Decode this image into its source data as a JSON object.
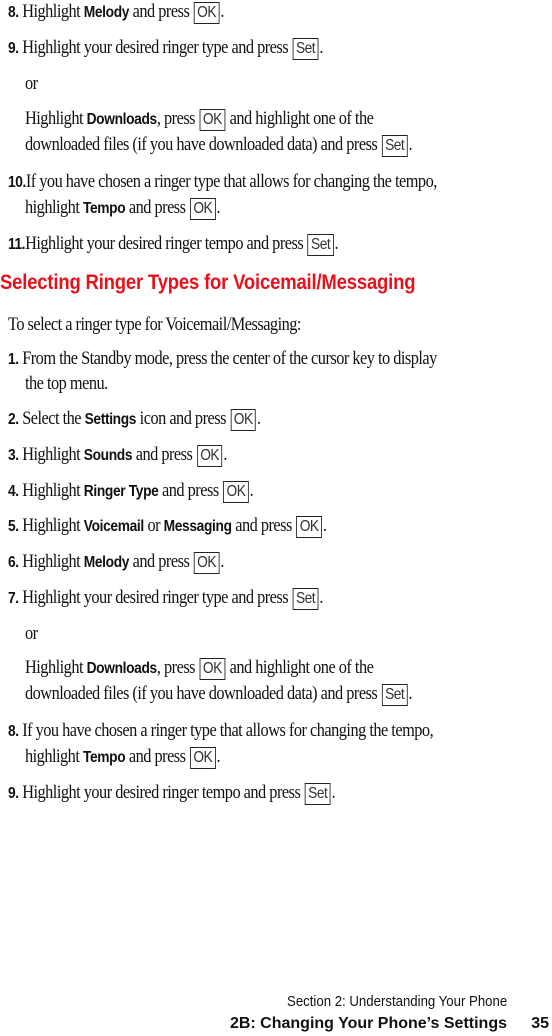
{
  "block1": {
    "s8": {
      "num": "8.",
      "pre": "Highlight ",
      "bold": "Melody",
      "post": " and press ",
      "key": "OK",
      "end": "."
    },
    "s9": {
      "num": "9.",
      "pre": "Highlight your desired ringer type and press ",
      "key": "Set",
      "end": "."
    },
    "or": "or",
    "alt_l1": {
      "pre": "Highlight ",
      "bold": "Downloads",
      "mid": ", press ",
      "key": "OK",
      "post": " and highlight one of the"
    },
    "alt_l2": {
      "pre": "downloaded files (if you have downloaded data) and press ",
      "key": "Set",
      "end": "."
    },
    "s10": {
      "num": "10.",
      "l1": "If you have chosen a ringer type that allows for changing the tempo,",
      "pre": "highlight ",
      "bold": "Tempo",
      "post": " and press ",
      "key": "OK",
      "end": "."
    },
    "s11": {
      "num": "11.",
      "pre": "Highlight your desired ringer tempo and press ",
      "key": "Set",
      "end": "."
    }
  },
  "heading": "Selecting Ringer Types for Voicemail/Messaging",
  "intro": "To select a ringer type for Voicemail/Messaging:",
  "block2": {
    "s1": {
      "num": "1.",
      "l1": "From the Standby mode, press the center of the cursor key to display",
      "l2": "the top menu."
    },
    "s2": {
      "num": "2.",
      "pre": "Select the ",
      "bold": "Settings",
      "post": " icon and press ",
      "key": "OK",
      "end": "."
    },
    "s3": {
      "num": "3.",
      "pre": "Highlight ",
      "bold": "Sounds",
      "post": " and press ",
      "key": "OK",
      "end": "."
    },
    "s4": {
      "num": "4.",
      "pre": "Highlight ",
      "bold": "Ringer Type",
      "post": " and press ",
      "key": "OK",
      "end": "."
    },
    "s5": {
      "num": "5.",
      "pre": "Highlight ",
      "bold": "Voicemail",
      "mid": " or ",
      "bold2": "Messaging",
      "post": " and press ",
      "key": "OK",
      "end": "."
    },
    "s6": {
      "num": "6.",
      "pre": "Highlight ",
      "bold": "Melody",
      "post": " and press ",
      "key": "OK",
      "end": "."
    },
    "s7": {
      "num": "7.",
      "pre": "Highlight your desired ringer type and press ",
      "key": "Set",
      "end": "."
    },
    "or": "or",
    "alt_l1": {
      "pre": "Highlight ",
      "bold": "Downloads",
      "mid": ", press ",
      "key": "OK",
      "post": " and highlight one of the"
    },
    "alt_l2": {
      "pre": "downloaded files (if you have downloaded data) and press ",
      "key": "Set",
      "end": "."
    },
    "s8": {
      "num": "8.",
      "l1": "If you have chosen a ringer type that allows for changing the tempo,",
      "pre": "highlight ",
      "bold": "Tempo",
      "post": " and press ",
      "key": "OK",
      "end": "."
    },
    "s9": {
      "num": "9.",
      "pre": "Highlight your desired ringer tempo and press ",
      "key": "Set",
      "end": "."
    }
  },
  "footer": {
    "section": "Section 2: Understanding Your Phone",
    "chapter": "2B: Changing Your Phone’s Settings",
    "page": "35"
  }
}
